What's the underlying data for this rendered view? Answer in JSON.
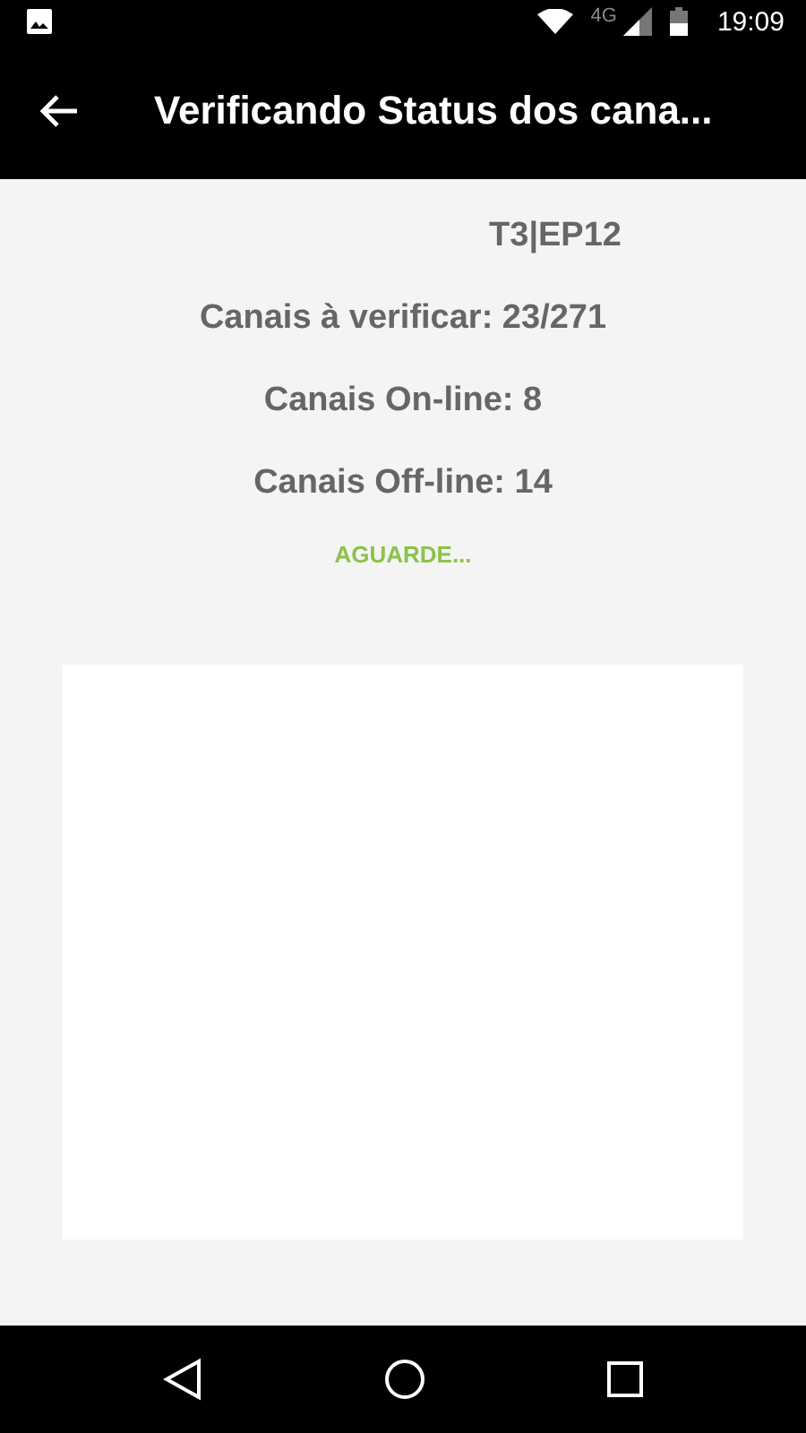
{
  "status_bar": {
    "time": "19:09",
    "network": "4G"
  },
  "app_bar": {
    "title": "Verificando Status dos cana..."
  },
  "content": {
    "episode": "T3|EP12",
    "lines": [
      "Canais à verificar: 23/271",
      "Canais On-line: 8",
      "Canais Off-line: 14"
    ],
    "message": "AGUARDE..."
  }
}
